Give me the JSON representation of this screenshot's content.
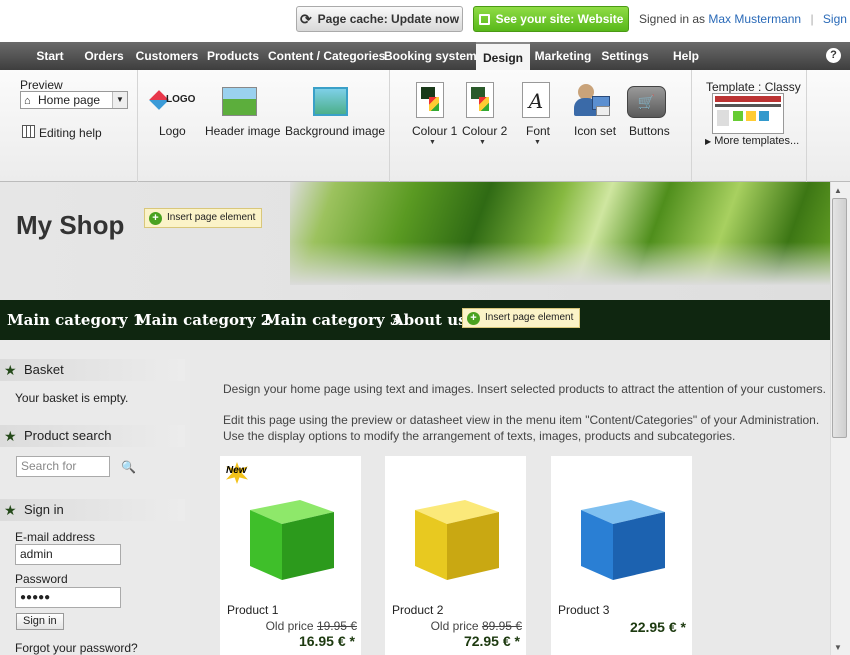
{
  "topbar": {
    "cache_button": "Page cache: Update now",
    "site_button": "See your site: Website",
    "signed_in_prefix": "Signed in as",
    "user_name": "Max Mustermann",
    "separator": "|",
    "sign_out": "Sign out"
  },
  "menu": {
    "items": [
      "Start",
      "Orders",
      "Customers",
      "Products",
      "Content / Categories",
      "Booking system",
      "Design",
      "Marketing",
      "Settings",
      "Help"
    ],
    "active": "Design",
    "help_icon": "?"
  },
  "ribbon": {
    "preview_label": "Preview",
    "preview_value": "Home page",
    "editing_help": "Editing help",
    "tools": {
      "logo": "Logo",
      "header_image": "Header image",
      "background_image": "Background image",
      "colour1": "Colour 1",
      "colour2": "Colour 2",
      "font": "Font",
      "icon_set": "Icon set",
      "buttons": "Buttons"
    },
    "logo_text": "LOGO",
    "font_glyph": "A",
    "template_label": "Template : Classy",
    "more_templates": "More templates..."
  },
  "shop": {
    "name": "My Shop",
    "insert_element": "Insert page element",
    "categories": [
      "Main category 1",
      "Main category 2",
      "Main category 3",
      "About us"
    ]
  },
  "sidebar": {
    "basket_title": "Basket",
    "basket_text": "Your basket is empty.",
    "search_title": "Product search",
    "search_placeholder": "Search for",
    "signin_title": "Sign in",
    "email_label": "E-mail address",
    "email_value": "admin",
    "password_label": "Password",
    "password_value": "●●●●●",
    "signin_button": "Sign in",
    "forgot": "Forgot your password?"
  },
  "main": {
    "intro1": "Design your home page using text and images. Insert selected products to attract the attention of your customers.",
    "intro2": "Edit this page using the preview or datasheet view in the menu item \"Content/Categories\" of your Administration.",
    "intro3": "Use the display options to modify the arrangement of texts, images, products and subcategories.",
    "new_badge": "New",
    "old_price_label": "Old price",
    "products": [
      {
        "name": "Product 1",
        "old_price": "19.95 €",
        "price": "16.95 € *",
        "color": "#3fbf2a"
      },
      {
        "name": "Product 2",
        "old_price": "89.95 €",
        "price": "72.95 € *",
        "color": "#e8c920"
      },
      {
        "name": "Product 3",
        "old_price": "",
        "price": "22.95 € *",
        "color": "#2a7fd4"
      }
    ]
  },
  "colors": {
    "menu_bg": "#4a4a4a",
    "category_bar": "#0f2610",
    "site_button": "#6ac42a",
    "link": "#2a6ab8",
    "price": "#1d3a10"
  },
  "icons": [
    "refresh-icon",
    "external-link-icon",
    "help-icon",
    "home-icon",
    "grid-icon",
    "logo-icon",
    "header-image-icon",
    "background-image-icon",
    "palette-icon",
    "font-icon",
    "icon-set-icon",
    "cart-button-icon",
    "star-icon",
    "magnifier-icon",
    "plus-icon"
  ]
}
